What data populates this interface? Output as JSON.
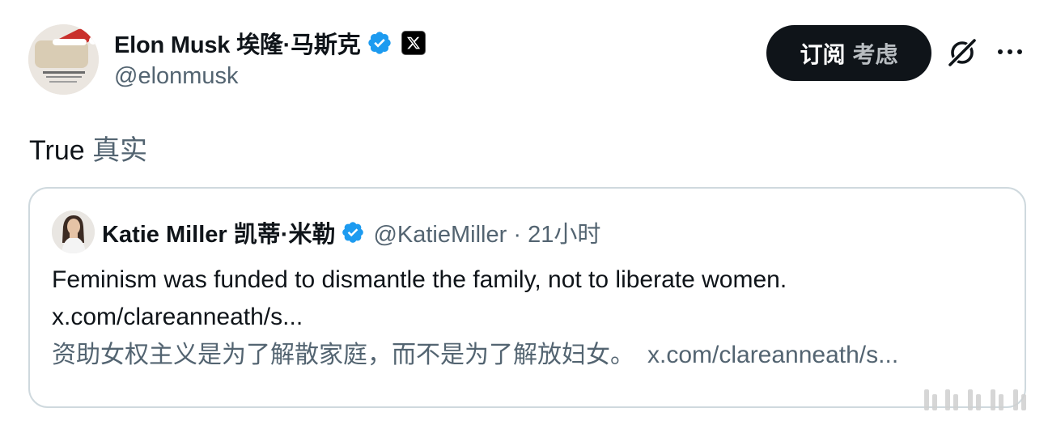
{
  "author": {
    "name": "Elon Musk",
    "name_translation": "埃隆·马斯克",
    "handle": "@elonmusk",
    "avatar_icon": "santa-hat-avatar",
    "verified_icon": "verified-badge-icon",
    "affiliate_badge": "x-logo-icon"
  },
  "actions": {
    "subscribe_label": "订阅",
    "subscribe_translation": "考虑",
    "grok_icon": "grok-icon",
    "more_icon": "more-options-icon"
  },
  "tweet": {
    "text": "True",
    "translation": "真实"
  },
  "quote": {
    "name": "Katie Miller",
    "name_translation": "凯蒂·米勒",
    "handle": "@KatieMiller",
    "separator": "·",
    "time": "21小时",
    "body_line1": "Feminism was funded to dismantle the family, not to liberate women.",
    "body_line2": "x.com/clareanneath/s...",
    "translation": "资助女权主义是为了解散家庭，而不是为了解放妇女。",
    "translation_link": "x.com/clareanneath/s..."
  },
  "colors": {
    "text_primary": "#0f1419",
    "text_secondary": "#536471",
    "verified_blue": "#1d9bf0",
    "border": "#cfd9de",
    "button_bg": "#0f1419"
  }
}
